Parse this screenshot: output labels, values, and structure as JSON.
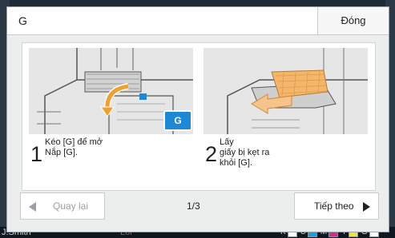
{
  "dialog": {
    "title": "G",
    "close_label": "Đóng",
    "page_indicator": "1/3",
    "prev_label": "Quay lại",
    "next_label": "Tiếp theo"
  },
  "illustration1": {
    "badge": "G"
  },
  "steps": [
    {
      "number": "1",
      "line1": "Kéo [G] để mở",
      "line2": "Nắp [G]."
    },
    {
      "number": "2",
      "line1": "Lấy",
      "line2": "giấy bị kẹt ra",
      "line3": "khỏi [G]."
    }
  ],
  "statusbar": {
    "user": "J.Smith",
    "error": "Lỗi",
    "inks": [
      "K",
      "C",
      "M",
      "Y",
      "G"
    ]
  },
  "colors": {
    "accent": "#1f88d4",
    "paper": "#f3b66a",
    "arrow": "#f0a030",
    "ink_c": "#1a9fd8",
    "ink_m": "#d62a8c",
    "ink_y": "#f2e23a"
  }
}
